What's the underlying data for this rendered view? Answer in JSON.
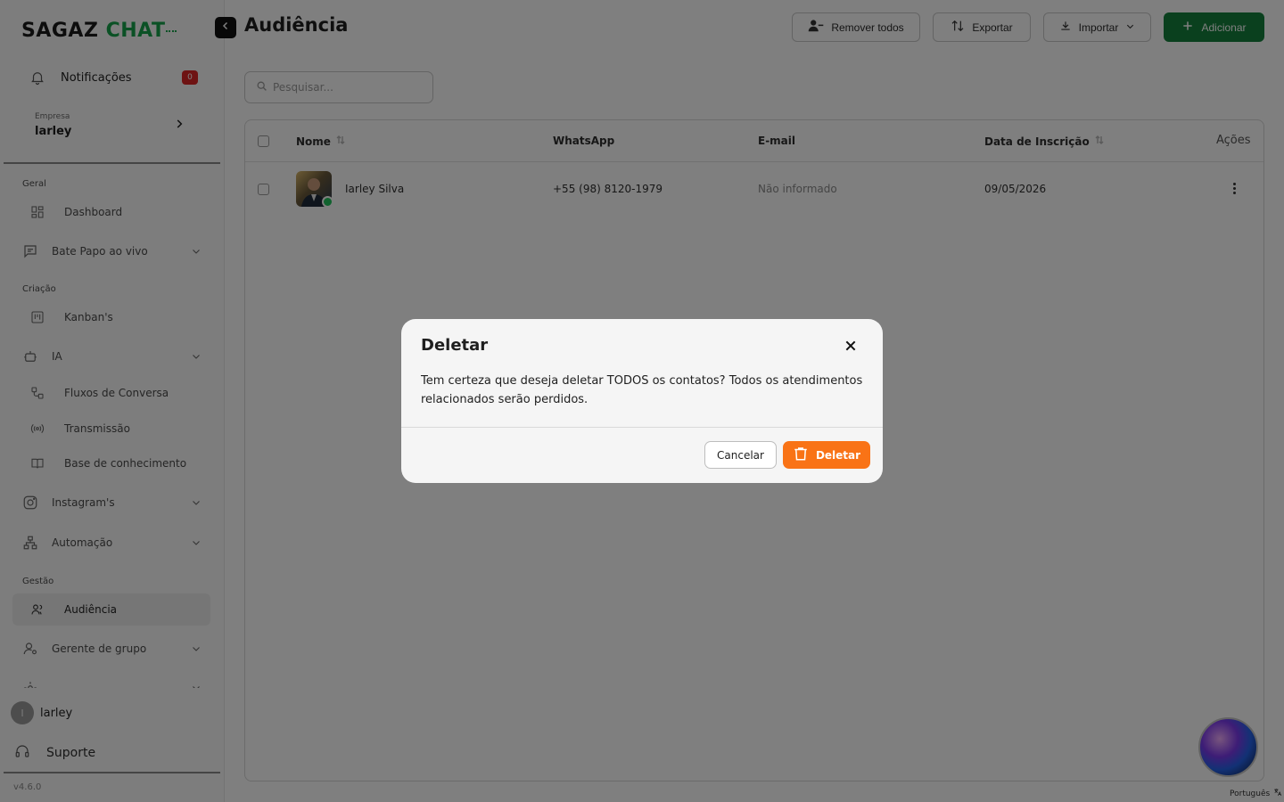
{
  "brand": {
    "name_part1": "SAGAZ ",
    "name_part2": "CHAT"
  },
  "sidebar": {
    "notifications": {
      "label": "Notificações",
      "count": "0"
    },
    "company": {
      "caption": "Empresa",
      "name": "larley"
    },
    "sections": [
      {
        "title": "Geral"
      },
      {
        "title": "Criação"
      },
      {
        "title": "Gestão"
      }
    ],
    "items": [
      {
        "label": "Dashboard",
        "icon": "dashboard-grid-icon"
      },
      {
        "label": "Bate Papo ao vivo",
        "icon": "chat-lines-icon"
      },
      {
        "label": "Kanban's",
        "icon": "kanban-icon"
      },
      {
        "label": "IA",
        "icon": "robot-icon"
      },
      {
        "label": "Fluxos de Conversa",
        "icon": "flow-icon"
      },
      {
        "label": "Transmissão",
        "icon": "broadcast-icon"
      },
      {
        "label": "Base de conhecimento",
        "icon": "book-icon"
      },
      {
        "label": "Instagram's",
        "icon": "instagram-icon"
      },
      {
        "label": "Automação",
        "icon": "automation-icon"
      },
      {
        "label": "Audiência",
        "icon": "users-icon"
      },
      {
        "label": "Gerente de grupo",
        "icon": "group-manager-icon"
      }
    ],
    "user": {
      "initial": "l",
      "name": "larley"
    },
    "support": "Suporte",
    "version": "v4.6.0"
  },
  "header": {
    "title": "Audiência",
    "buttons": {
      "remove_all": "Remover todos",
      "export": "Exportar",
      "import": "Importar",
      "add": "Adicionar"
    }
  },
  "search": {
    "placeholder": "Pesquisar..."
  },
  "table": {
    "columns": [
      "Nome",
      "WhatsApp",
      "E-mail",
      "Data de Inscrição",
      "Ações"
    ],
    "rows": [
      {
        "name": "Iarley Silva",
        "whatsapp": "+55 (98) 8120-1979",
        "email": "Não informado",
        "date": "09/05/2026"
      }
    ]
  },
  "footer": {
    "language": "Português"
  },
  "modal": {
    "title": "Deletar",
    "message": "Tem certeza que deseja deletar TODOS os contatos? Todos os atendimentos relacionados serão perdidos.",
    "cancel": "Cancelar",
    "confirm": "Deletar"
  },
  "colors": {
    "brand_green": "#15803d",
    "danger_orange": "#f97316",
    "badge_red": "#dc2626"
  }
}
